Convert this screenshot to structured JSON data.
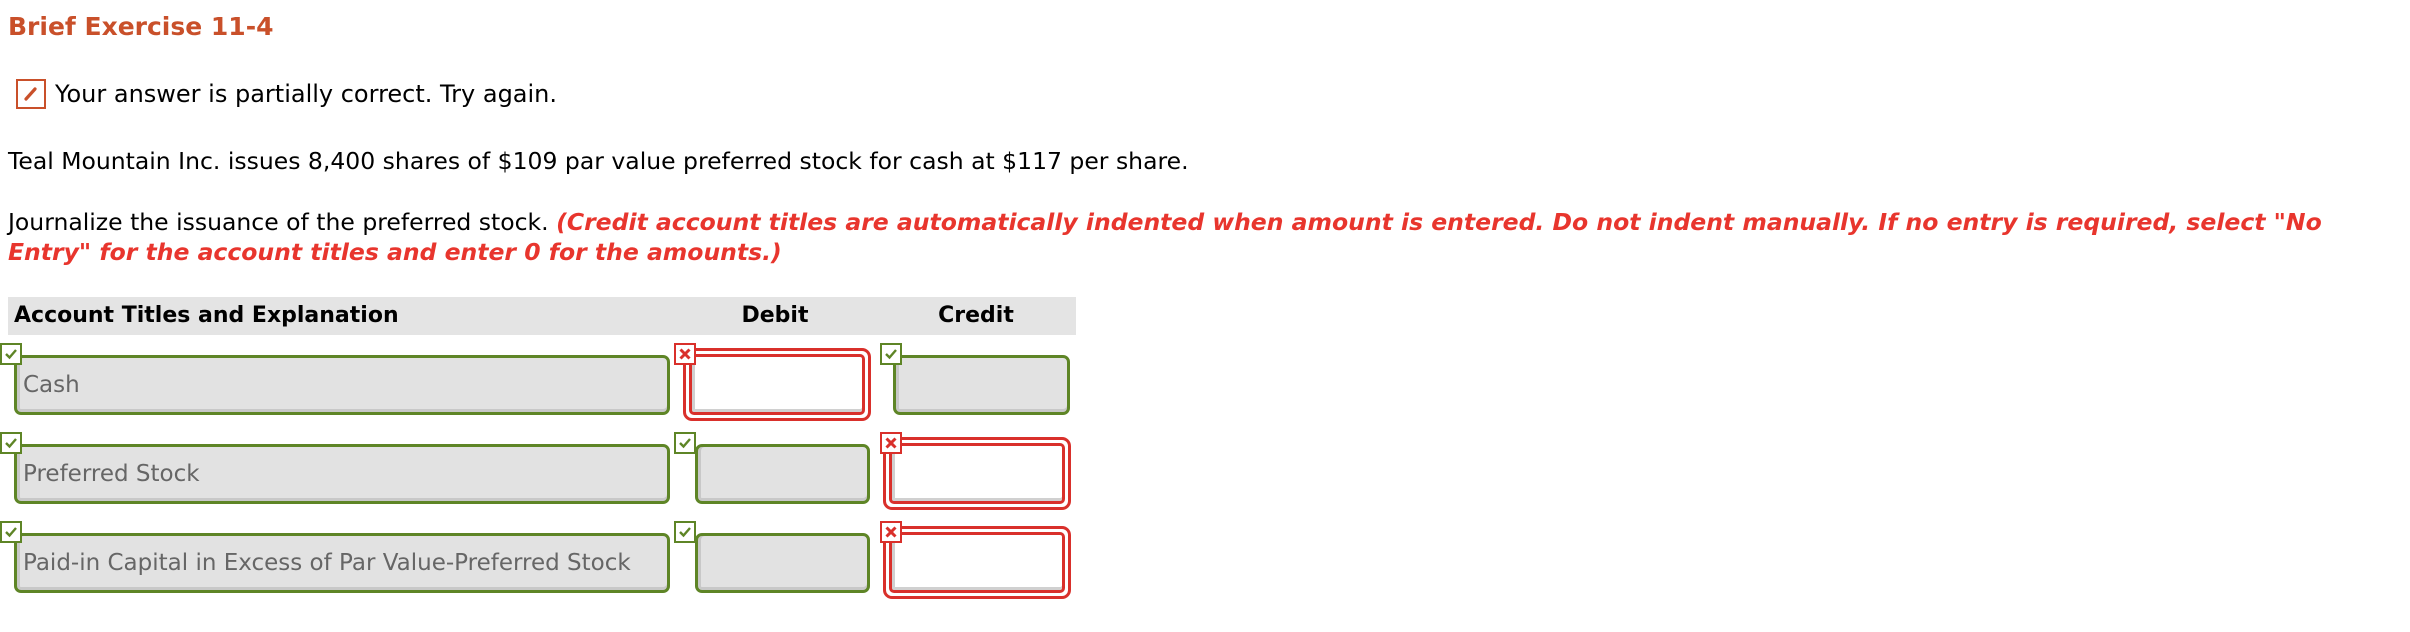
{
  "title": "Brief Exercise 11-4",
  "status": {
    "icon": "pencil-icon",
    "text": "Your answer is partially correct.  Try again."
  },
  "problem": "Teal Mountain Inc. issues 8,400 shares of $109 par value preferred stock for cash at $117 per share.",
  "instruction": {
    "text": "Journalize the issuance of the preferred stock. ",
    "note": "(Credit account titles are automatically indented when amount is entered. Do not indent manually. If no entry is required, select \"No Entry\" for the account titles and enter 0 for the amounts.)"
  },
  "colors": {
    "title": "#c9502a",
    "note": "#e8352d",
    "correct": "#5e8526",
    "incorrect": "#d9302b"
  },
  "table": {
    "headers": {
      "account": "Account Titles and Explanation",
      "debit": "Debit",
      "credit": "Credit"
    },
    "rows": [
      {
        "account": {
          "value": "Cash",
          "status": "correct"
        },
        "debit": {
          "value": "",
          "status": "incorrect"
        },
        "credit": {
          "value": "",
          "status": "correct"
        }
      },
      {
        "account": {
          "value": "Preferred Stock",
          "status": "correct"
        },
        "debit": {
          "value": "",
          "status": "correct"
        },
        "credit": {
          "value": "",
          "status": "incorrect"
        }
      },
      {
        "account": {
          "value": "Paid-in Capital in Excess of Par Value-Preferred Stock",
          "status": "correct"
        },
        "debit": {
          "value": "",
          "status": "correct"
        },
        "credit": {
          "value": "",
          "status": "incorrect"
        }
      }
    ]
  }
}
